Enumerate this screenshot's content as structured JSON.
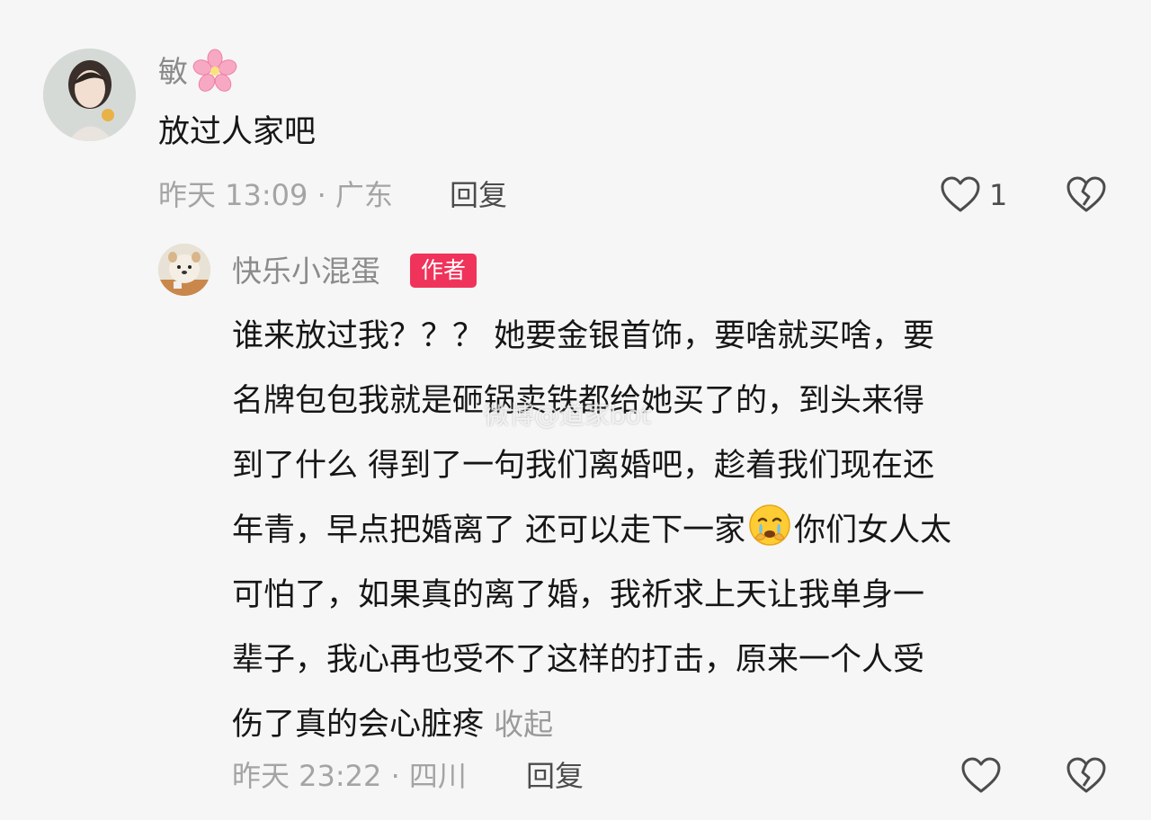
{
  "comment": {
    "username": "敏",
    "username_emoji": "cherry-blossom",
    "text": "放过人家吧",
    "meta": "昨天 13:09 · 广东",
    "reply_label": "回复",
    "like_count": "1"
  },
  "reply": {
    "username": "快乐小混蛋",
    "badge": "作者",
    "lines": [
      "谁来放过我？？？ 她要金银首饰，要啥就买啥，要",
      "名牌包包我就是砸锅卖铁都给她买了的，到头来得",
      "到了什么 得到了一句我们离婚吧，趁着我们现在还",
      "年青，早点把婚离了 还可以走下一家",
      "可怕了，如果真的离了婚，我祈求上天让我单身一",
      "辈子，我心再也受不了这样的打击，原来一个人受",
      "伤了真的会心脏疼"
    ],
    "line4_after_emoji": "你们女人太",
    "inline_emoji": "crying-face",
    "collapse_label": "收起",
    "meta": "昨天 23:22 · 四川",
    "reply_label": "回复"
  },
  "watermark": "微博@道家bot",
  "colors": {
    "background": "#f6f6f6",
    "badge": "#f0335a",
    "meta_text": "#a4a4a4",
    "username": "#8b8b8b"
  }
}
